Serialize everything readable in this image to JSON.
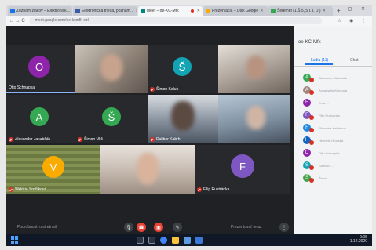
{
  "browser": {
    "tabs": [
      {
        "label": "Zoznam žiakov – Elektronick…",
        "color": "#1a73e8",
        "active": false,
        "recording": false
      },
      {
        "label": "Elektronická trieda, poznám…",
        "color": "#3b5ba9",
        "active": false,
        "recording": false
      },
      {
        "label": "Meet – oe-KC-Mfk",
        "color": "#00897b",
        "active": true,
        "recording": true
      },
      {
        "label": "Prezentácia – Disk Google",
        "color": "#f9ab00",
        "active": false,
        "recording": false
      },
      {
        "label": "Šeřemet (1.Š 5, 5.I. I. D.)",
        "color": "#34a853",
        "active": false,
        "recording": false
      }
    ],
    "new_tab": "+",
    "window_controls": "– ▢ ✕",
    "nav": "← → C",
    "url": "meet.google.com/oe-kcmfk-ezk",
    "extensions": "☆ ◉ ⋮"
  },
  "meeting": {
    "tiles": [
      {
        "name": "Otto Schnapka",
        "initial": "O",
        "avatar_color": "#8e24aa",
        "has_video": false
      },
      {
        "name": "",
        "initial": "",
        "avatar_color": "",
        "has_video": true,
        "tone": "#9c8f84"
      },
      {
        "name": "Šimon Kaluk",
        "initial": "Š",
        "avatar_color": "#12a4b4",
        "has_video": false
      },
      {
        "name": "",
        "initial": "",
        "avatar_color": "",
        "has_video": true,
        "tone": "#a79a8e"
      },
      {
        "name": "Alexander Jakubčák",
        "initial": "A",
        "avatar_color": "#34a853",
        "has_video": false
      },
      {
        "name": "Šimon Ulič",
        "initial": "Š",
        "avatar_color": "#34a853",
        "has_video": false
      },
      {
        "name": "Dalibor Kabrh",
        "initial": "",
        "avatar_color": "",
        "has_video": true,
        "tone": "#7d8796"
      },
      {
        "name": "",
        "initial": "",
        "avatar_color": "",
        "has_video": true,
        "tone": "#8da3b8"
      },
      {
        "name": "Viktória Srnčíková",
        "initial": "V",
        "avatar_color": "#f9ab00",
        "has_video": false
      },
      {
        "name": "",
        "initial": "",
        "avatar_color": "",
        "has_video": true,
        "tone": "#b5a89d"
      },
      {
        "name": "Filip Rustránka",
        "initial": "F",
        "avatar_color": "#7e57c2",
        "has_video": false
      }
    ],
    "controls": {
      "left_text": "Podrobnosti o stretnutí",
      "right_text": "Prezentovať teraz"
    }
  },
  "panel": {
    "title": "oe-KC-Mfk",
    "tab_people": "Ľudia (11)",
    "tab_chat": "Chat",
    "participants": [
      {
        "initial": "A",
        "color": "#34a853",
        "name": "Alexander Jakubčák"
      },
      {
        "initial": "A",
        "color": "#a1887f",
        "name": "Annamária Kobzová"
      },
      {
        "initial": "E",
        "color": "#8e24aa",
        "name": "Ema …"
      },
      {
        "initial": "F",
        "color": "#7e57c2",
        "name": "Filip Rustránka"
      },
      {
        "initial": "F",
        "color": "#1e88e5",
        "name": "Filomena Kabrhová"
      },
      {
        "initial": "H",
        "color": "#1565c0",
        "name": "Henrieta Hronská"
      },
      {
        "initial": "O",
        "color": "#8e24aa",
        "name": "Otto Schnapka"
      },
      {
        "initial": "S",
        "color": "#12a4b4",
        "name": "Samuel …"
      },
      {
        "initial": "Š",
        "color": "#43a047",
        "name": "Šimon …"
      }
    ]
  },
  "taskbar": {
    "time": "9:05",
    "date": "1.12.2020"
  }
}
